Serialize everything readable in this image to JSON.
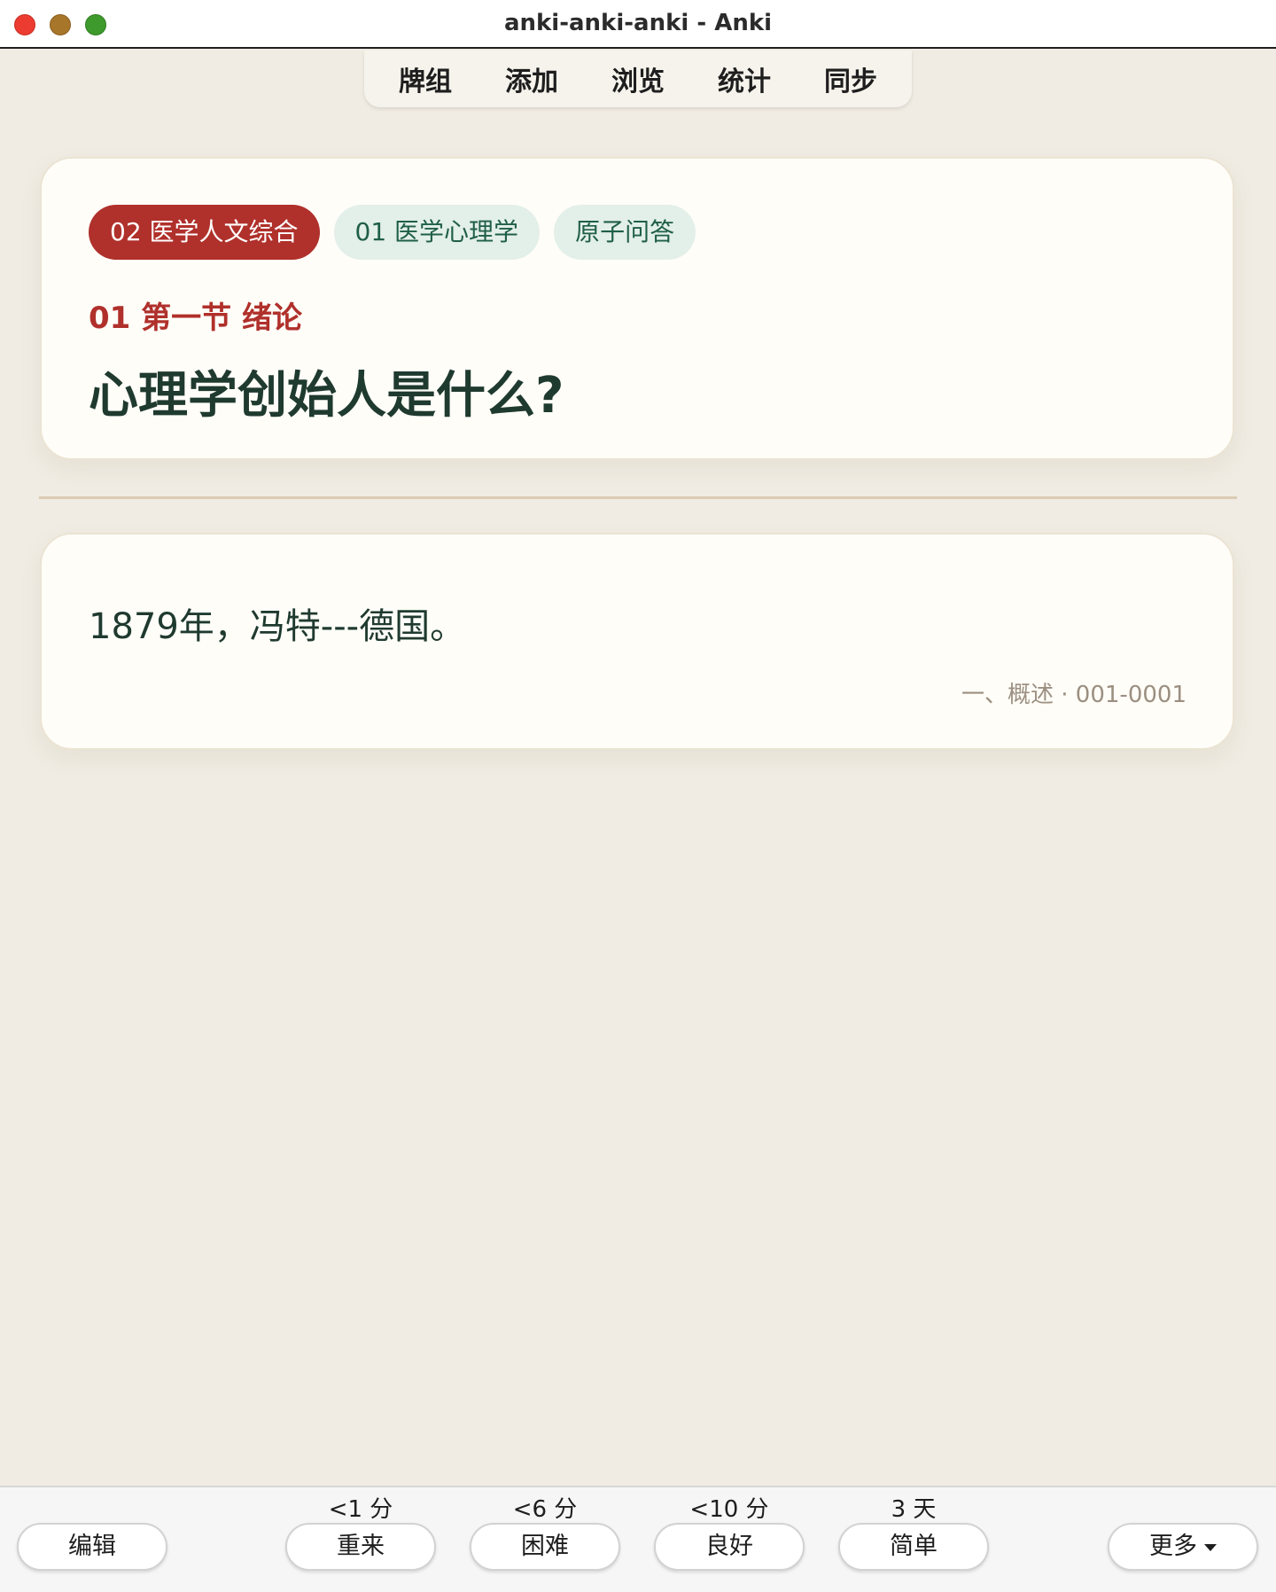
{
  "window": {
    "title": "anki-anki-anki - Anki"
  },
  "toolbar": {
    "items": [
      "牌组",
      "添加",
      "浏览",
      "统计",
      "同步"
    ]
  },
  "card": {
    "tags": [
      "02 医学人文综合",
      "01 医学心理学",
      "原子问答"
    ],
    "section": "01 第一节 绪论",
    "question": "心理学创始人是什么?",
    "answer": "1879年，冯特---德国。",
    "source": "一、概述 · 001-0001"
  },
  "bottom": {
    "edit": "编辑",
    "more": "更多",
    "answers": [
      {
        "interval": "<1 分",
        "label": "重来"
      },
      {
        "interval": "<6 分",
        "label": "困难"
      },
      {
        "interval": "<10 分",
        "label": "良好"
      },
      {
        "interval": "3 天",
        "label": "简单"
      }
    ]
  },
  "colors": {
    "background": "#f0ece3",
    "card": "#fffdf8",
    "accent_red": "#b0302b",
    "tag_green_bg": "#e3efe9",
    "tag_green_text": "#1f5f48",
    "text_dark_green": "#1f3a2f"
  }
}
